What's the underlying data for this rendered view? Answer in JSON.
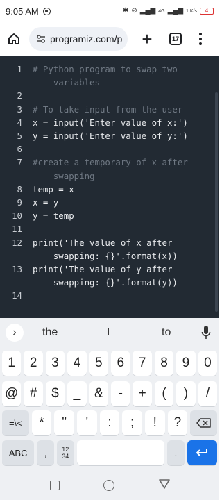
{
  "status": {
    "time": "9:05 AM",
    "net_speed": "1 K/s",
    "signal_label": "4G",
    "battery": "4"
  },
  "browser": {
    "url": "programiz.com/p",
    "tab_count": "17"
  },
  "editor": {
    "lines": [
      {
        "n": "1",
        "t": "# Python program to swap two"
      },
      {
        "n": "",
        "t": "    variables"
      },
      {
        "n": "2",
        "t": ""
      },
      {
        "n": "3",
        "t": "# To take input from the user"
      },
      {
        "n": "4",
        "t": "x = input('Enter value of x:')"
      },
      {
        "n": "5",
        "t": "y = input('Enter value of y:')"
      },
      {
        "n": "6",
        "t": ""
      },
      {
        "n": "7",
        "t": "#create a temporary of x after"
      },
      {
        "n": "",
        "t": "    swapping"
      },
      {
        "n": "8",
        "t": "temp = x"
      },
      {
        "n": "9",
        "t": "x = y"
      },
      {
        "n": "10",
        "t": "y = temp"
      },
      {
        "n": "11",
        "t": ""
      },
      {
        "n": "12",
        "t": "print('The value of x after"
      },
      {
        "n": "",
        "t": "    swapping: {}'.format(x))"
      },
      {
        "n": "13",
        "t": "print('The value of y after"
      },
      {
        "n": "",
        "t": "    swapping: {}'.format(y))"
      },
      {
        "n": "14",
        "t": ""
      }
    ]
  },
  "keyboard": {
    "suggestions": [
      "the",
      "I",
      "to"
    ],
    "row_numbers": [
      "1",
      "2",
      "3",
      "4",
      "5",
      "6",
      "7",
      "8",
      "9",
      "0"
    ],
    "row_symbols1": [
      "@",
      "#",
      "$",
      "_",
      "&",
      "-",
      "+",
      "(",
      ")",
      "/"
    ],
    "row_symbols2": [
      "=\\<",
      "*",
      "\"",
      "'",
      ":",
      ";",
      "!",
      "?"
    ],
    "abc_label": "ABC",
    "comma": ",",
    "numpad_label": "12\n34",
    "period": "."
  }
}
